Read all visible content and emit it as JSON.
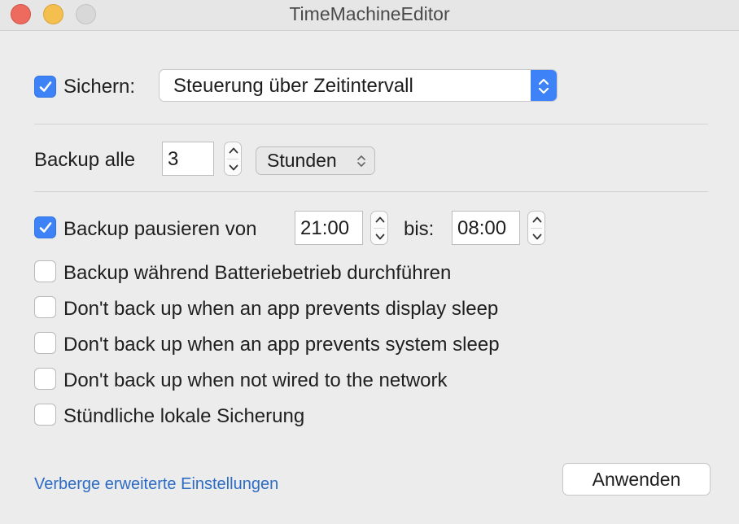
{
  "window": {
    "title": "TimeMachineEditor"
  },
  "backup": {
    "enabled": true,
    "label": "Sichern:",
    "mode": "Steuerung über Zeitintervall"
  },
  "interval": {
    "label": "Backup alle",
    "value": "3",
    "unit": "Stunden"
  },
  "pause": {
    "enabled": true,
    "label": "Backup pausieren von",
    "from": "21:00",
    "to_label": "bis:",
    "to": "08:00"
  },
  "options": [
    {
      "label": "Backup während Batteriebetrieb durchführen",
      "checked": false
    },
    {
      "label": "Don't back up when an app prevents display sleep",
      "checked": false
    },
    {
      "label": "Don't back up when an app prevents system sleep",
      "checked": false
    },
    {
      "label": "Don't back up when not wired to the network",
      "checked": false
    },
    {
      "label": "Stündliche lokale Sicherung",
      "checked": false
    }
  ],
  "footer": {
    "advanced_link": "Verberge erweiterte Einstellungen",
    "apply_button": "Anwenden"
  },
  "colors": {
    "accent": "#3d82f6",
    "link": "#2c6cc4",
    "background": "#ececec"
  }
}
